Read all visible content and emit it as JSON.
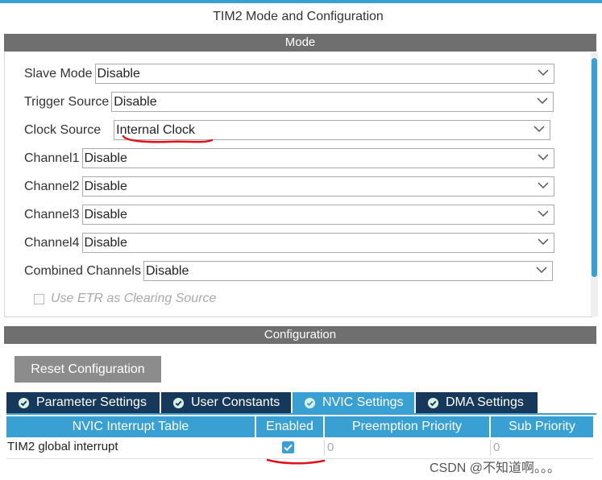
{
  "window": {
    "title": "TIM2 Mode and Configuration"
  },
  "mode": {
    "heading": "Mode",
    "fields": [
      {
        "label": "Slave Mode",
        "value": "Disable"
      },
      {
        "label": "Trigger Source",
        "value": "Disable"
      },
      {
        "label": "Clock Source",
        "value": "Internal Clock"
      },
      {
        "label": "Channel1",
        "value": "Disable"
      },
      {
        "label": "Channel2",
        "value": "Disable"
      },
      {
        "label": "Channel3",
        "value": "Disable"
      },
      {
        "label": "Channel4",
        "value": "Disable"
      },
      {
        "label": "Combined Channels",
        "value": "Disable"
      }
    ],
    "etr_checkbox": {
      "label": "Use ETR as Clearing Source",
      "checked": false,
      "disabled": true
    }
  },
  "configuration": {
    "heading": "Configuration",
    "reset_label": "Reset Configuration",
    "tabs": [
      {
        "label": "Parameter Settings",
        "active": false
      },
      {
        "label": "User Constants",
        "active": false
      },
      {
        "label": "NVIC Settings",
        "active": true
      },
      {
        "label": "DMA Settings",
        "active": false
      }
    ],
    "nvic_table": {
      "columns": [
        "NVIC Interrupt Table",
        "Enabled",
        "Preemption Priority",
        "Sub Priority"
      ],
      "rows": [
        {
          "name": "TIM2 global interrupt",
          "enabled": true,
          "preemption": "0",
          "sub": "0"
        }
      ]
    }
  },
  "watermark": "CSDN @不知道啊。。。",
  "colors": {
    "accent": "#39a0d4",
    "tab_dark": "#16385a",
    "band": "#6f6f6f",
    "annotation": "#e0121b"
  }
}
